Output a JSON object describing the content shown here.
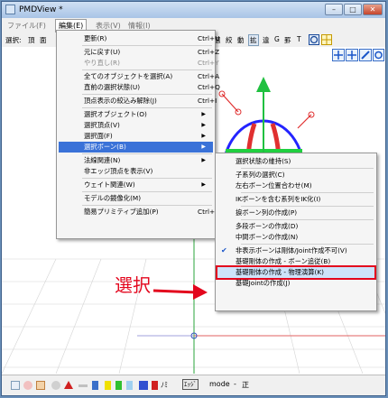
{
  "window": {
    "title": "PMDView *",
    "minimize": "–",
    "maximize": "□",
    "close": "✕"
  },
  "menubar": [
    {
      "label": "ファイル(F)",
      "active": false
    },
    {
      "label": "編集(E)",
      "active": true
    },
    {
      "label": "表示(V)",
      "active": false
    },
    {
      "label": "情報(I)",
      "active": false
    }
  ],
  "toolbar": {
    "left": [
      "選択:",
      "頂",
      "面"
    ],
    "right": [
      {
        "label": "選",
        "boxed": false
      },
      {
        "label": "絞",
        "boxed": false
      },
      {
        "label": "動",
        "boxed": false
      },
      {
        "label": "拡",
        "boxed": true
      },
      {
        "label": "違",
        "boxed": false
      },
      {
        "label": "G",
        "boxed": false
      },
      {
        "label": "罫",
        "boxed": false
      },
      {
        "label": "T",
        "boxed": false
      }
    ]
  },
  "edit_menu": {
    "items": [
      {
        "label": "更新(R)",
        "shortcut": "Ctrl+U"
      },
      {
        "sep": true
      },
      {
        "label": "元に戻す(U)",
        "shortcut": "Ctrl+Z"
      },
      {
        "label": "やり直し(R)",
        "shortcut": "Ctrl+Y",
        "disabled": true
      },
      {
        "sep": true
      },
      {
        "label": "全てのオブジェクトを選択(A)",
        "shortcut": "Ctrl+A"
      },
      {
        "label": "直前の選択状態(U)",
        "shortcut": "Ctrl+Q"
      },
      {
        "sep": true
      },
      {
        "label": "頂点表示の絞込み解除(J)",
        "shortcut": "Ctrl+I"
      },
      {
        "sep": true
      },
      {
        "label": "選択オブジェクト(O)",
        "arrow": true
      },
      {
        "label": "選択頂点(V)",
        "arrow": true
      },
      {
        "label": "選択面(F)",
        "arrow": true
      },
      {
        "label": "選択ボーン(B)",
        "arrow": true,
        "highlighted": true
      },
      {
        "sep": true
      },
      {
        "label": "法線関連(N)",
        "arrow": true
      },
      {
        "label": "非エッジ頂点を表示(V)"
      },
      {
        "sep": true
      },
      {
        "label": "ウェイト関連(W)",
        "arrow": true
      },
      {
        "sep": true
      },
      {
        "label": "モデルの鏡像化(M)"
      },
      {
        "sep": true
      },
      {
        "label": "簡易プリミティブ追加(P)",
        "shortcut": "Ctrl+P"
      }
    ]
  },
  "bone_submenu": {
    "items": [
      {
        "label": "選択状態の維持(S)"
      },
      {
        "sep": true
      },
      {
        "label": "子系列の選択(C)"
      },
      {
        "label": "左右ボーン位置合わせ(M)"
      },
      {
        "sep": true
      },
      {
        "label": "IKボーンを含む系列をIK化(I)"
      },
      {
        "sep": true
      },
      {
        "label": "捩ボーン列の作成(P)"
      },
      {
        "sep": true
      },
      {
        "label": "多段ボーンの作成(D)"
      },
      {
        "label": "中間ボーンの作成(N)"
      },
      {
        "sep": true
      },
      {
        "label": "非表示ボーンは剛体/Joint作成不可(V)",
        "checked": true
      },
      {
        "label": "基礎剛体の作成 - ボーン追従(B)"
      },
      {
        "label": "基礎剛体の作成 - 物理演算(K)",
        "boxed": true
      },
      {
        "label": "基礎Jointの作成(J)"
      }
    ]
  },
  "annotation": {
    "text": "選択",
    "color": "#e3061d"
  },
  "status": {
    "mode_label": "mode",
    "mode_sep": "-",
    "mode_value": "正",
    "edge_label": "ｴｯｼﾞ",
    "norm_label": "ﾉﾐ"
  },
  "colors": {
    "highlight": "#3a72d8",
    "annotation": "#e3061d"
  }
}
